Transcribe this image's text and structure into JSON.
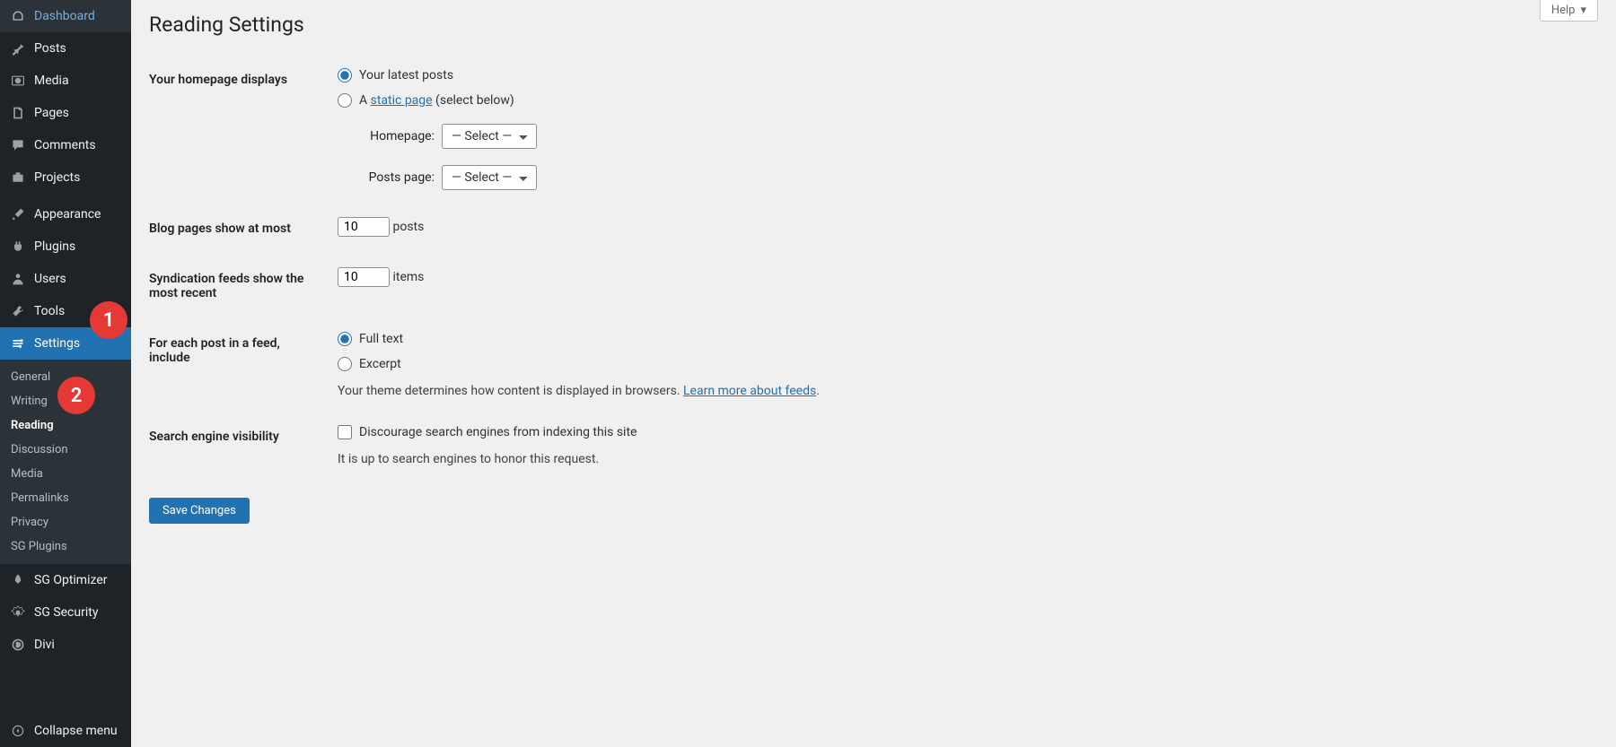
{
  "sidebar": {
    "dashboard": "Dashboard",
    "posts": "Posts",
    "media": "Media",
    "pages": "Pages",
    "comments": "Comments",
    "projects": "Projects",
    "appearance": "Appearance",
    "plugins": "Plugins",
    "users": "Users",
    "tools": "Tools",
    "settings": "Settings",
    "sub": {
      "general": "General",
      "writing": "Writing",
      "reading": "Reading",
      "discussion": "Discussion",
      "media": "Media",
      "permalinks": "Permalinks",
      "privacy": "Privacy",
      "sgplugins": "SG Plugins"
    },
    "sgoptimizer": "SG Optimizer",
    "sgsecurity": "SG Security",
    "divi": "Divi",
    "collapse": "Collapse menu"
  },
  "help": "Help",
  "title": "Reading Settings",
  "homepage": {
    "label": "Your homepage displays",
    "opt1": "Your latest posts",
    "opt2_a": "A ",
    "opt2_link": "static page",
    "opt2_b": " (select below)",
    "home_label": "Homepage:",
    "posts_label": "Posts page:",
    "select_placeholder": "— Select —"
  },
  "blog": {
    "label": "Blog pages show at most",
    "value": "10",
    "unit": "posts"
  },
  "synd": {
    "label": "Syndication feeds show the most recent",
    "value": "10",
    "unit": "items"
  },
  "feed": {
    "label": "For each post in a feed, include",
    "opt1": "Full text",
    "opt2": "Excerpt",
    "desc_a": "Your theme determines how content is displayed in browsers. ",
    "desc_link": "Learn more about feeds",
    "desc_b": "."
  },
  "search": {
    "label": "Search engine visibility",
    "check": "Discourage search engines from indexing this site",
    "desc": "It is up to search engines to honor this request."
  },
  "save": "Save Changes",
  "badges": {
    "b1": "1",
    "b2": "2"
  }
}
